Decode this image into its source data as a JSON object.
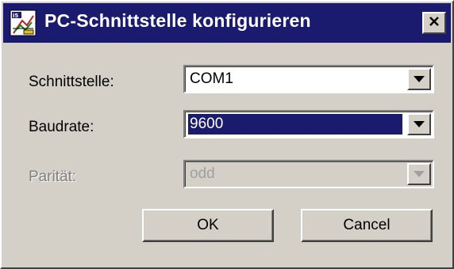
{
  "window": {
    "title": "PC-Schnittstelle konfigurieren",
    "icon": "app-config-icon",
    "close_icon": "close-icon",
    "colors": {
      "titlebar": "#1a1a6e",
      "face": "#d4d0c8",
      "selection": "#1a1a6e"
    }
  },
  "form": {
    "interface": {
      "label": "Schnittstelle:",
      "value": "COM1",
      "enabled": true
    },
    "baudrate": {
      "label": "Baudrate:",
      "value": "9600",
      "enabled": true,
      "focused": true
    },
    "parity": {
      "label": "Parität:",
      "value": "odd",
      "enabled": false
    }
  },
  "buttons": {
    "ok_label": "OK",
    "cancel_label": "Cancel"
  }
}
